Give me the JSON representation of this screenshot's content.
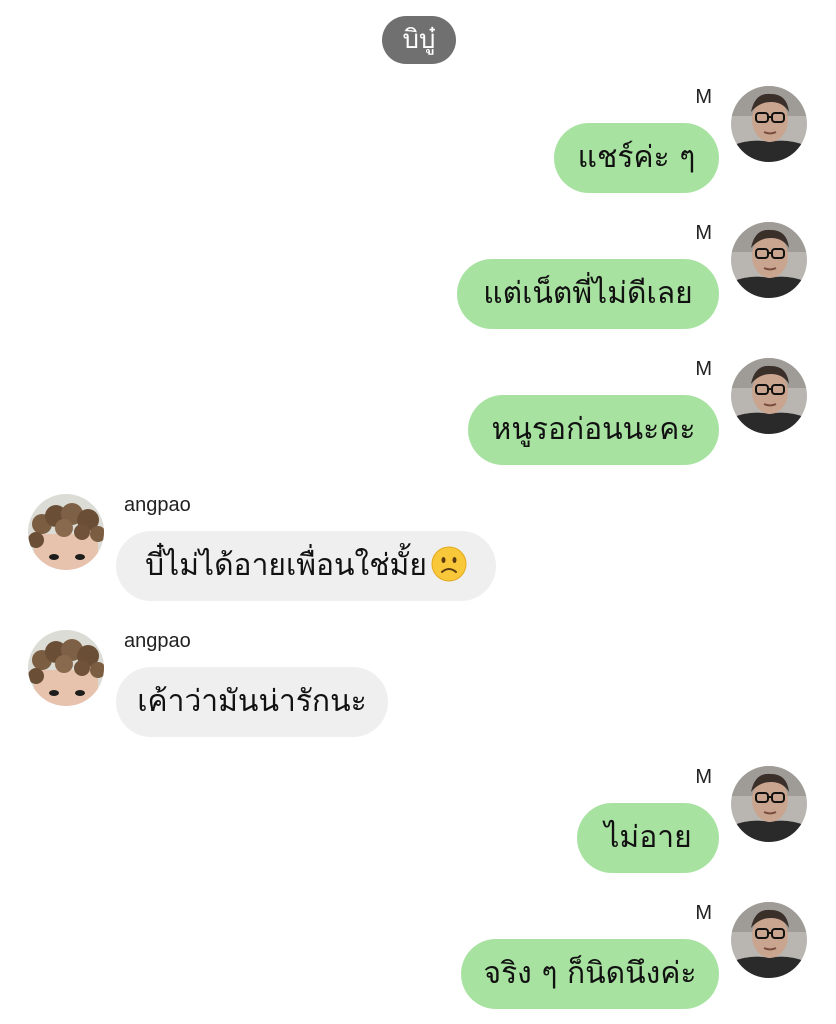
{
  "header": {
    "pill_label": "บิบู๋"
  },
  "messages": [
    {
      "side": "out",
      "sender": "M",
      "text": "แชร์ค่ะ ๆ"
    },
    {
      "side": "out",
      "sender": "M",
      "text": "แต่เน็ตพี่ไม่ดีเลย"
    },
    {
      "side": "out",
      "sender": "M",
      "text": "หนูรอก่อนนะคะ"
    },
    {
      "side": "in",
      "sender": "angpao",
      "text": "บี๋ไม่ได้อายเพื่อนใช่มั้ย",
      "emoji": "slightly-frowning-face"
    },
    {
      "side": "in",
      "sender": "angpao",
      "text": "เค้าว่ามันน่ารักนะ"
    },
    {
      "side": "out",
      "sender": "M",
      "text": "ไม่อาย"
    },
    {
      "side": "out",
      "sender": "M",
      "text": "จริง ๆ ก็นิดนึงค่ะ"
    }
  ],
  "colors": {
    "outgoing_bubble": "#a8e2a1",
    "incoming_bubble": "#efefef",
    "pill_background": "#707070"
  },
  "avatars": {
    "M": "person-with-glasses-avatar",
    "angpao": "curly-hair-avatar"
  }
}
